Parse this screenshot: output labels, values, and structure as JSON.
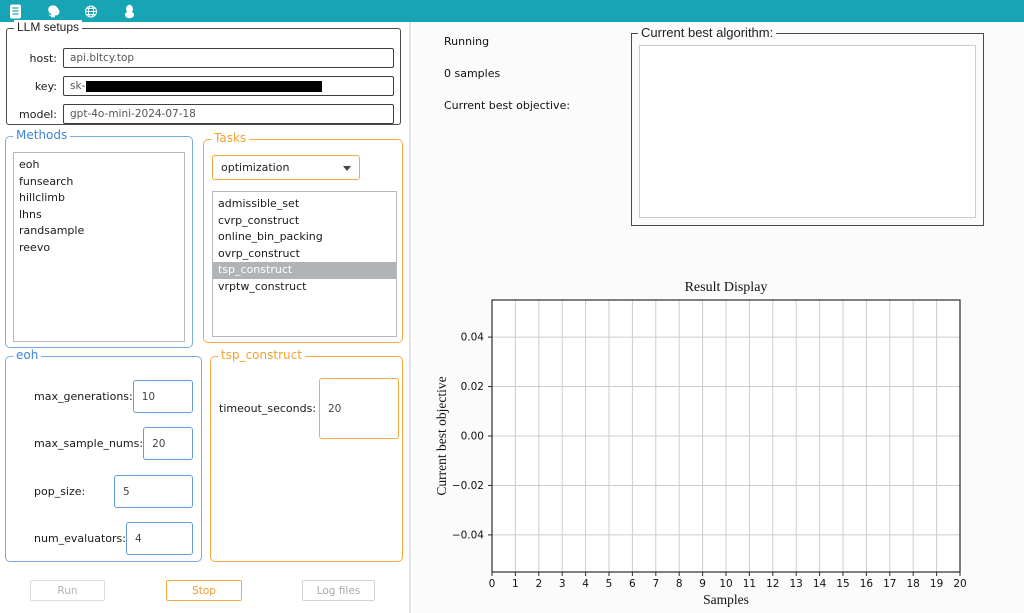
{
  "topbar": {
    "color": "#17a4b4",
    "icons": [
      "docs-icon",
      "github-icon",
      "website-icon",
      "qq-icon"
    ]
  },
  "llm_setups": {
    "title": "LLM setups",
    "fields": [
      {
        "label": "host:",
        "value": "api.bltcy.top"
      },
      {
        "label": "key:",
        "value": "sk-",
        "redacted": true
      },
      {
        "label": "model:",
        "value": "gpt-4o-mini-2024-07-18"
      }
    ]
  },
  "methods": {
    "title": "Methods",
    "items": [
      "eoh",
      "funsearch",
      "hillclimb",
      "lhns",
      "randsample",
      "reevo"
    ]
  },
  "tasks": {
    "title": "Tasks",
    "dropdown_value": "optimization",
    "items": [
      "admissible_set",
      "cvrp_construct",
      "online_bin_packing",
      "ovrp_construct",
      "tsp_construct",
      "vrptw_construct"
    ],
    "selected_item": "tsp_construct"
  },
  "eoh_params": {
    "title": "eoh",
    "fields": [
      {
        "label": "max_generations:",
        "value": "10"
      },
      {
        "label": "max_sample_nums:",
        "value": "20"
      },
      {
        "label": "pop_size:",
        "value": "5"
      },
      {
        "label": "num_evaluators:",
        "value": "4"
      }
    ]
  },
  "task_params": {
    "title": "tsp_construct",
    "fields": [
      {
        "label": "timeout_seconds:",
        "value": "20"
      }
    ]
  },
  "buttons": {
    "run": "Run",
    "stop": "Stop",
    "logs": "Log files"
  },
  "status": {
    "state": "Running",
    "samples": "0 samples",
    "objective_label": "Current best objective:"
  },
  "algorithm_box": {
    "title": "Current best algorithm:",
    "content": ""
  },
  "colors": {
    "accent_teal": "#17a4b4",
    "accent_blue": "#7caae0",
    "accent_orange": "#f4ab42",
    "list_select_bg": "#b0b4b6",
    "grid": "#cccccc"
  },
  "chart_data": {
    "type": "line",
    "title": "Result Display",
    "xlabel": "Samples",
    "ylabel": "Current best objective",
    "xlim": [
      0,
      20
    ],
    "ylim": [
      -0.055,
      0.055
    ],
    "xticks": [
      0,
      1,
      2,
      3,
      4,
      5,
      6,
      7,
      8,
      9,
      10,
      11,
      12,
      13,
      14,
      15,
      16,
      17,
      18,
      19,
      20
    ],
    "ytick_values": [
      0.04,
      0.02,
      0.0,
      -0.02,
      -0.04
    ],
    "ytick_labels": [
      "0.04",
      "0.02",
      "0.00",
      "−0.02",
      "−0.04"
    ],
    "grid": true,
    "legend": null,
    "series": []
  }
}
